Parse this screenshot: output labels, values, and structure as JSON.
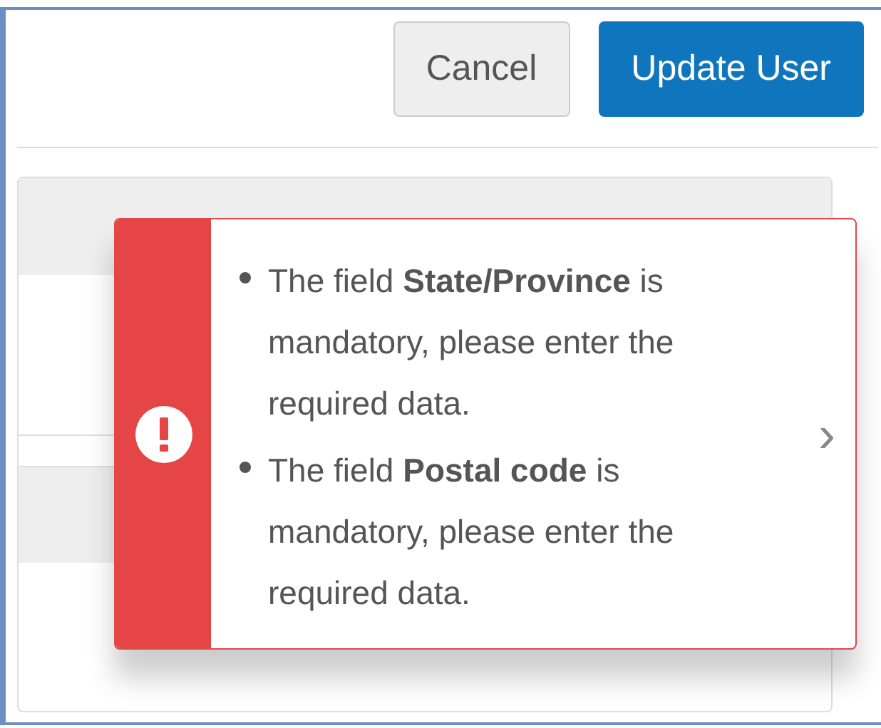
{
  "actions": [
    {
      "label": "Cancel",
      "kind": "secondary"
    },
    {
      "label": "Update User",
      "kind": "primary"
    }
  ],
  "error_toast": {
    "messages": [
      "The field **State/Province** is mandatory, please enter the required data.",
      "The field **Postal code** is mandatory, please enter the required data."
    ],
    "expand": "›"
  }
}
